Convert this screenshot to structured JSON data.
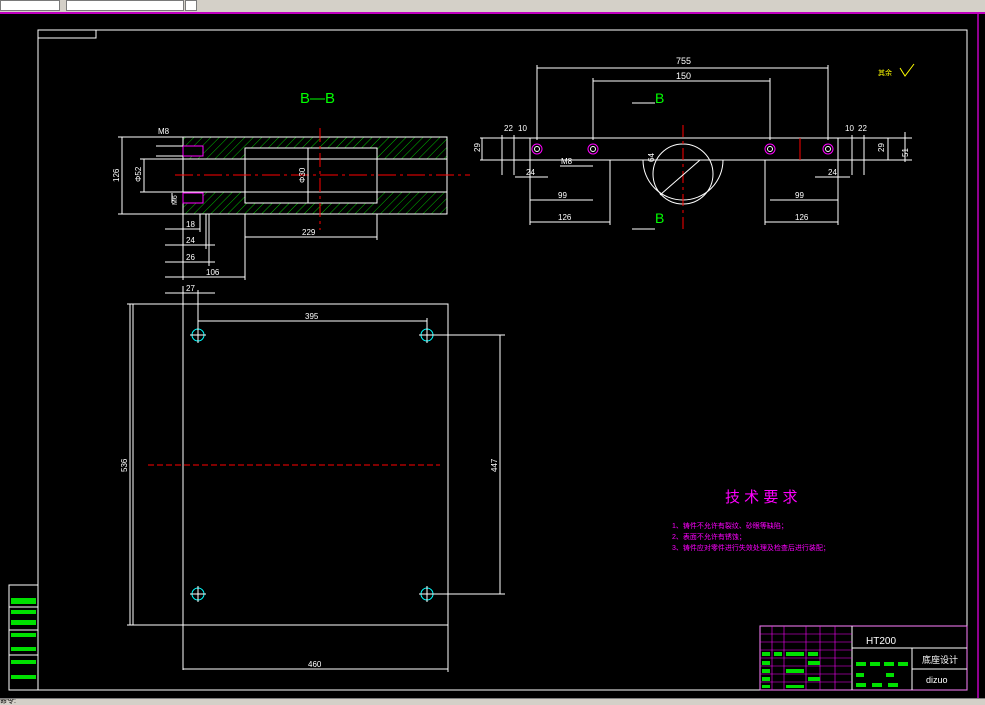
{
  "section_label": "B—B",
  "section_marker": "B",
  "surface_note": "其余",
  "tech_title": "技 术 要 求",
  "tech_notes": [
    "1、铸件不允许有裂纹、砂眼等缺陷；",
    "2、表面不允许有锈蚀；",
    "3、铸件应对零件进行失效处理及检查后进行装配；"
  ],
  "dims": {
    "m8": "M8",
    "d126_left": "126",
    "d52": "Φ52",
    "d30": "Φ30",
    "m6": "M6",
    "d18": "18",
    "d24": "24",
    "d26": "26",
    "d106": "106",
    "d229": "229",
    "d755": "755",
    "d150": "150",
    "d22_l": "22",
    "d10_l": "10",
    "d22_r": "22",
    "d10_r": "10",
    "d29_l": "29",
    "d29_r": "29",
    "d51": "51",
    "d64": "64",
    "d99_l": "99",
    "d99_r": "99",
    "d126_l": "126",
    "d126_r": "126",
    "d24_l": "24",
    "d24_r": "24",
    "d27": "27",
    "d395": "395",
    "d536": "536",
    "d447": "447",
    "d460": "460"
  },
  "title_block": {
    "material": "HT200",
    "part_name": "底座设计",
    "drawing_code": "dizuo"
  },
  "command_line": "命令:",
  "colors": {
    "background": "#000000",
    "outline": "#ffffff",
    "centerline": "#ff0000",
    "hatch": "#00c000",
    "section_text": "#00ff00",
    "notes": "#ff00ff",
    "surface_symbol": "#ffff00"
  }
}
